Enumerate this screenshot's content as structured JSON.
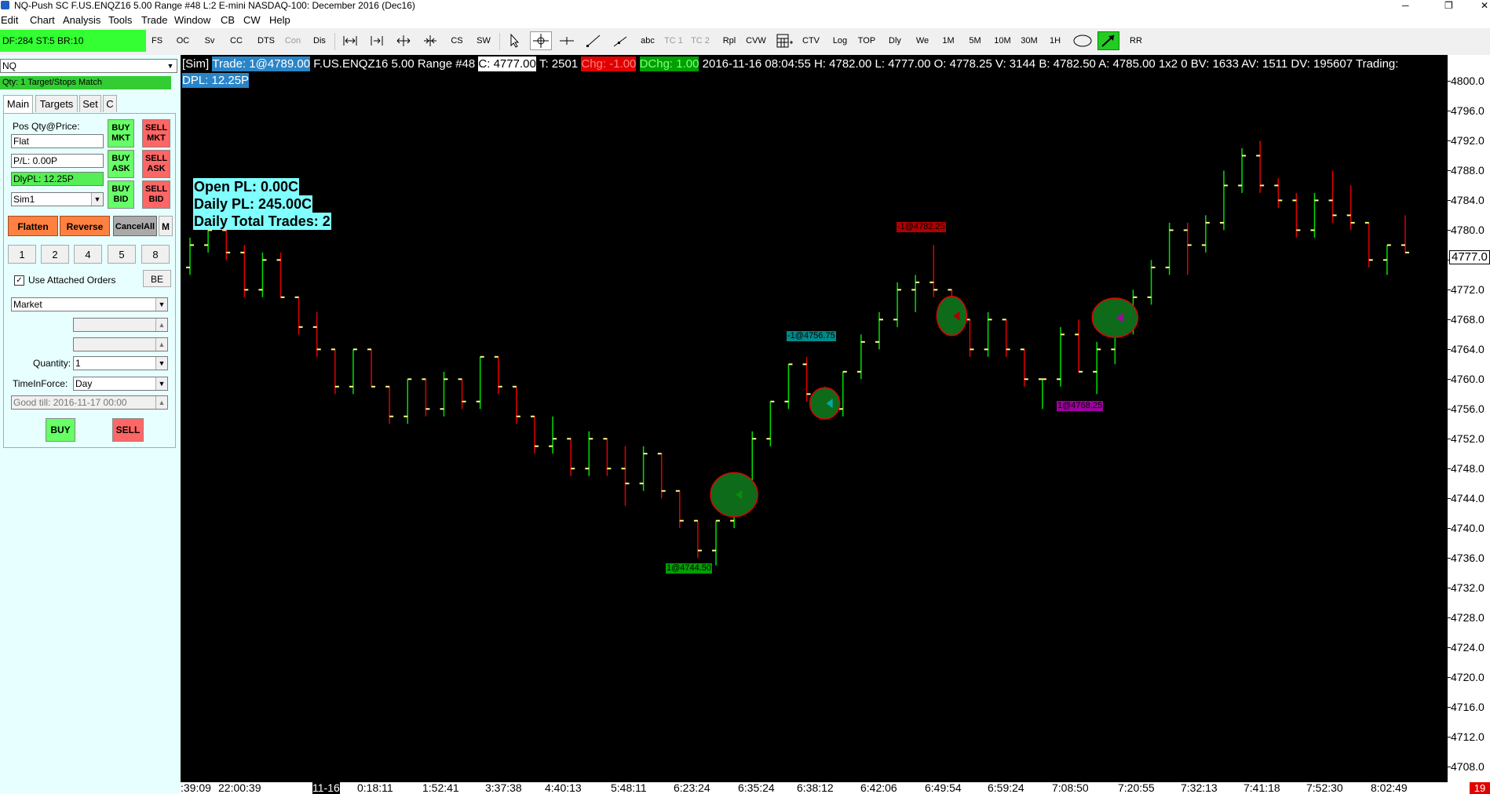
{
  "window": {
    "title": "NQ-Push  SC F.US.ENQZ16  5.00 Range  #48  L:2  E-mini NASDAQ-100: December 2016 (Dec16)",
    "controls": {
      "minimize": "─",
      "maximize": "❐",
      "close": "✕"
    }
  },
  "menu": [
    "Edit",
    "Chart",
    "Analysis",
    "Tools",
    "Trade",
    "Window",
    "CB",
    "CW",
    "Help"
  ],
  "toolbar": {
    "status": "DF:284  ST:5  BR:10",
    "buttons": [
      "FS",
      "OC",
      "Sv",
      "CC",
      "DTS",
      "Con",
      "Dis",
      "CS",
      "SW",
      "abc",
      "TC 1",
      "TC 2",
      "Rpl",
      "CVW",
      "CTV",
      "Log",
      "TOP",
      "Dly",
      "We",
      "1M",
      "5M",
      "10M",
      "30M",
      "1H",
      "RR"
    ],
    "icons": [
      "bar-width-icon",
      "bar-spacing-icon",
      "zoom-out-icon",
      "zoom-in-icon",
      "pointer-icon",
      "crosshair-icon",
      "horizontal-line-icon",
      "line-icon",
      "ray-icon",
      "calculator-icon",
      "ellipse-icon",
      "arrow-icon"
    ]
  },
  "trade_panel": {
    "symbol": "NQ",
    "target_status": "Qty: 1 Target/Stops Match",
    "tabs": [
      "Main",
      "Targets",
      "Set",
      "C"
    ],
    "pos_label": "Pos Qty@Price:",
    "position": "Flat",
    "pl": "P/L: 0.00P",
    "daily_pl": "DlyPL: 12.25P",
    "account": "Sim1",
    "buy_mkt": "BUY MKT",
    "sell_mkt": "SELL MKT",
    "buy_ask": "BUY ASK",
    "sell_ask": "SELL ASK",
    "buy_bid": "BUY BID",
    "sell_bid": "SELL BID",
    "flatten": "Flatten",
    "reverse": "Reverse",
    "cancel_all": "CancelAll",
    "m": "M",
    "quick_qty": [
      "1",
      "2",
      "4",
      "5",
      "8"
    ],
    "use_attached_orders": "Use Attached Orders",
    "be": "BE",
    "order_type": "Market",
    "quantity_label": "Quantity:",
    "quantity": "1",
    "tif_label": "TimeInForce:",
    "tif": "Day",
    "good_till": "Good till: 2016-11-17 00:00",
    "buy": "BUY",
    "sell": "SELL"
  },
  "chart_info": {
    "mode": "[Sim]",
    "trade": "Trade: 1@4789.00",
    "symbol": "F.US.ENQZ16  5.00 Range  #48",
    "close": "C: 4777.00",
    "ticks": "T: 2501",
    "chg": "Chg: -1.00",
    "dchg": "DChg: 1.00",
    "rest": "2016-11-16 08:04:55  H: 4782.00  L: 4777.00  O: 4778.25  V: 3144  B: 4782.50  A: 4785.00  1x2 0  BV: 1633  AV: 1511  DV: 195607  Trading:",
    "dpl": "DPL: 12.25P"
  },
  "pl_overlay": {
    "open_pl": "Open PL: 0.00C",
    "daily_pl": "Daily PL: 245.00C",
    "total_trades": "Daily Total Trades: 2"
  },
  "fill_labels": [
    {
      "text": "1@4744.50",
      "bg": "#00a000",
      "fg": "#000000"
    },
    {
      "text": "-1@4756.75",
      "bg": "#008a8a",
      "fg": "#000000"
    },
    {
      "text": "-1@4782.25",
      "bg": "#b00000",
      "fg": "#000000"
    },
    {
      "text": "1@4768.25",
      "bg": "#a000a0",
      "fg": "#000000"
    }
  ],
  "current_price": "4777.0",
  "corner_value": "19",
  "colors": {
    "up": "#00e000",
    "down": "#e00000",
    "tick": "#ffff80",
    "panel": "#e8ffff",
    "accent": "#33ff33"
  },
  "chart_data": {
    "type": "bar",
    "ylim": [
      4706,
      4801
    ],
    "y_ticks": [
      "4800.0",
      "4796.0",
      "4792.0",
      "4788.0",
      "4784.0",
      "4780.0",
      "4776.0",
      "4772.0",
      "4768.0",
      "4764.0",
      "4760.0",
      "4756.0",
      "4752.0",
      "4748.0",
      "4744.0",
      "4740.0",
      "4736.0",
      "4732.0",
      "4728.0",
      "4724.0",
      "4720.0",
      "4716.0",
      "4712.0",
      "4708.0"
    ],
    "x_ticks": [
      ":39:09",
      "22:00:39",
      "11-16",
      "0:18:11",
      "1:52:41",
      "3:37:38",
      "4:40:13",
      "5:48:11",
      "6:23:24",
      "6:35:24",
      "6:38:12",
      "6:42:06",
      "6:49:54",
      "6:59:24",
      "7:08:50",
      "7:20:55",
      "7:32:13",
      "7:41:18",
      "7:52:30",
      "8:02:49"
    ],
    "ohlc": [
      [
        4775,
        4779,
        4774,
        4778
      ],
      [
        4778,
        4781,
        4777,
        4780
      ],
      [
        4780,
        4781,
        4776,
        4777
      ],
      [
        4777,
        4778,
        4771,
        4772
      ],
      [
        4772,
        4777,
        4771,
        4776
      ],
      [
        4776,
        4777,
        4771,
        4771
      ],
      [
        4771,
        4771,
        4766,
        4767
      ],
      [
        4767,
        4769,
        4763,
        4764
      ],
      [
        4764,
        4764,
        4758,
        4759
      ],
      [
        4759,
        4764,
        4758,
        4764
      ],
      [
        4764,
        4764,
        4759,
        4759
      ],
      [
        4759,
        4759,
        4754,
        4755
      ],
      [
        4755,
        4760,
        4754,
        4760
      ],
      [
        4760,
        4760,
        4755,
        4756
      ],
      [
        4756,
        4761,
        4755,
        4760
      ],
      [
        4760,
        4760,
        4756,
        4757
      ],
      [
        4757,
        4763,
        4756,
        4763
      ],
      [
        4763,
        4763,
        4758,
        4759
      ],
      [
        4759,
        4759,
        4754,
        4755
      ],
      [
        4755,
        4755,
        4750,
        4751
      ],
      [
        4751,
        4755,
        4750,
        4752
      ],
      [
        4752,
        4752,
        4747,
        4748
      ],
      [
        4748,
        4753,
        4747,
        4752
      ],
      [
        4752,
        4752,
        4747,
        4748
      ],
      [
        4748,
        4751,
        4743,
        4746
      ],
      [
        4746,
        4751,
        4745,
        4750
      ],
      [
        4750,
        4750,
        4744,
        4745
      ],
      [
        4745,
        4745,
        4740,
        4741
      ],
      [
        4741,
        4741,
        4736,
        4737
      ],
      [
        4737,
        4741,
        4735,
        4741
      ],
      [
        4741,
        4746,
        4740,
        4746
      ],
      [
        4746,
        4753,
        4745,
        4752
      ],
      [
        4752,
        4757,
        4751,
        4757
      ],
      [
        4757,
        4762,
        4756,
        4762
      ],
      [
        4762,
        4763,
        4757,
        4758
      ],
      [
        4758,
        4759,
        4755,
        4756
      ],
      [
        4756,
        4761,
        4755,
        4761
      ],
      [
        4761,
        4766,
        4760,
        4765
      ],
      [
        4765,
        4769,
        4764,
        4768
      ],
      [
        4768,
        4773,
        4767,
        4772
      ],
      [
        4772,
        4774,
        4769,
        4773
      ],
      [
        4773,
        4778,
        4771,
        4772
      ],
      [
        4772,
        4772,
        4767,
        4768
      ],
      [
        4768,
        4768,
        4763,
        4764
      ],
      [
        4764,
        4769,
        4763,
        4768
      ],
      [
        4768,
        4768,
        4763,
        4764
      ],
      [
        4764,
        4764,
        4759,
        4760
      ],
      [
        4760,
        4760,
        4756,
        4760
      ],
      [
        4760,
        4767,
        4759,
        4766
      ],
      [
        4766,
        4768,
        4761,
        4761
      ],
      [
        4761,
        4765,
        4758,
        4764
      ],
      [
        4764,
        4769,
        4762,
        4768
      ],
      [
        4768,
        4772,
        4766,
        4771
      ],
      [
        4771,
        4776,
        4770,
        4775
      ],
      [
        4775,
        4781,
        4774,
        4780
      ],
      [
        4780,
        4781,
        4774,
        4778
      ],
      [
        4778,
        4782,
        4777,
        4781
      ],
      [
        4781,
        4788,
        4780,
        4786
      ],
      [
        4786,
        4791,
        4785,
        4790
      ],
      [
        4790,
        4792,
        4785,
        4786
      ],
      [
        4786,
        4787,
        4783,
        4784
      ],
      [
        4784,
        4785,
        4779,
        4780
      ],
      [
        4780,
        4785,
        4779,
        4784
      ],
      [
        4784,
        4788,
        4781,
        4782
      ],
      [
        4782,
        4786,
        4780,
        4781
      ],
      [
        4781,
        4781,
        4775,
        4776
      ],
      [
        4776,
        4778,
        4774,
        4778
      ],
      [
        4778,
        4782,
        4777,
        4777
      ]
    ]
  }
}
